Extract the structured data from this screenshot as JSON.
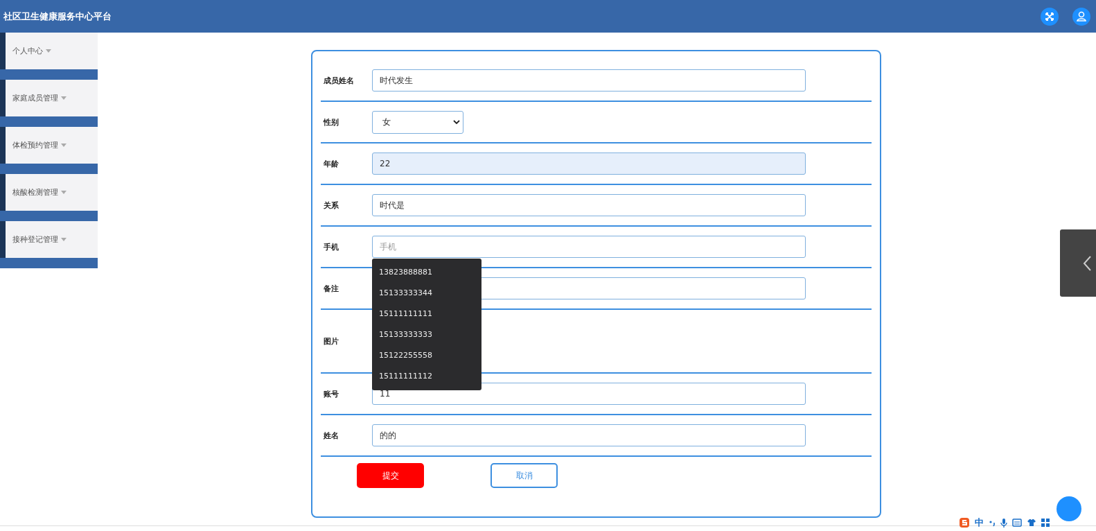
{
  "header": {
    "title": "社区卫生健康服务中心平台"
  },
  "sidebar": {
    "items": [
      {
        "label": "个人中心",
        "expanded": false
      },
      {
        "label": "家庭成员管理",
        "expanded": false
      },
      {
        "label": "体检预约管理",
        "expanded": false
      },
      {
        "label": "核酸检测管理",
        "expanded": false
      },
      {
        "label": "接种登记管理",
        "expanded": false
      }
    ]
  },
  "form": {
    "fields": [
      {
        "kind": "input",
        "label": "成员姓名",
        "value": "时代发生",
        "disabled": false
      },
      {
        "kind": "select",
        "label": "性别",
        "value": "女"
      },
      {
        "kind": "input",
        "label": "年龄",
        "value": "22",
        "disabled": true
      },
      {
        "kind": "input",
        "label": "关系",
        "value": "时代是",
        "disabled": false
      },
      {
        "kind": "input",
        "label": "手机",
        "placeholder": "手机",
        "disabled": false,
        "suggestions": [
          "13823888881",
          "15133333344",
          "15111111111",
          "15133333333",
          "15122255558",
          "15111111112"
        ]
      },
      {
        "kind": "input",
        "label": "备注",
        "disabled": false
      },
      {
        "kind": "image",
        "label": "图片"
      },
      {
        "kind": "input",
        "label": "账号",
        "value": "11",
        "disabled": false
      },
      {
        "kind": "input",
        "label": "姓名",
        "value": "的的",
        "disabled": false
      }
    ],
    "buttons": [
      {
        "kind": "primary",
        "label": "提交"
      },
      {
        "kind": "outline",
        "label": "取消"
      }
    ]
  },
  "ime_toolbar": {
    "mode": "中"
  }
}
